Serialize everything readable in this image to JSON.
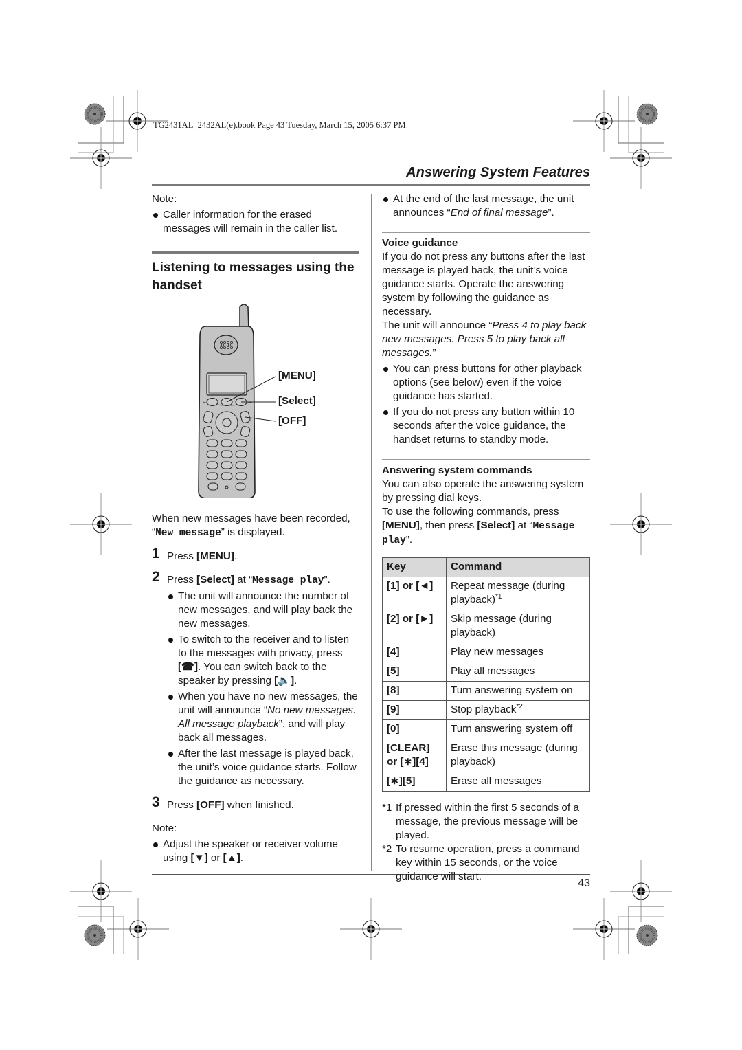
{
  "slug": "TG2431AL_2432AL(e).book  Page 43  Tuesday, March 15, 2005  6:37 PM",
  "section_title": "Answering System Features",
  "page_number": "43",
  "left": {
    "note1": {
      "label": "Note:",
      "bullet": "Caller information for the erased messages will remain in the caller list."
    },
    "heading": "Listening to messages using the handset",
    "figure": {
      "callouts": [
        "[MENU]",
        "[Select]",
        "[OFF]"
      ]
    },
    "intro_a": "When new messages have been recorded, “",
    "intro_lcd": "New message",
    "intro_b": "” is displayed.",
    "steps": [
      {
        "num": "1",
        "a": "Press ",
        "key": "[MENU]",
        "b": "."
      },
      {
        "num": "2",
        "a": "Press ",
        "key": "[Select]",
        "b": " at “",
        "lcd": "Message play",
        "c": "”."
      },
      {
        "num": "3",
        "a": "Press ",
        "key": "[OFF]",
        "b": " when finished."
      }
    ],
    "step2_bullets": {
      "b1": "The unit will announce the number of new messages, and will play back the new messages.",
      "b2_a": "To switch to the receiver and to listen to the messages with privacy, press ",
      "b2_key1": "[☎]",
      "b2_b": ". You can switch back to the speaker by pressing ",
      "b2_key2": "[🔈]",
      "b2_c": ".",
      "b3_a": "When you have no new messages, the unit will announce “",
      "b3_i": "No new messages. All message playback",
      "b3_b": "”, and will play back all messages.",
      "b4": "After the last message is played back, the unit’s voice guidance starts. Follow the guidance as necessary."
    },
    "note2": {
      "label": "Note:",
      "a": "Adjust the speaker or receiver volume using ",
      "key1": "[▼]",
      "mid": " or ",
      "key2": "[▲]",
      "b": "."
    }
  },
  "right": {
    "top_bullet_a": "At the end of the last message, the unit announces “",
    "top_bullet_i": "End of final message",
    "top_bullet_b": "”.",
    "voice": {
      "title": "Voice guidance",
      "p1": "If you do not press any buttons after the last message is played back, the unit’s voice guidance starts. Operate the answering system by following the guidance as necessary.",
      "p2_a": "The unit will announce “",
      "p2_i": "Press 4 to play back new messages. Press 5 to play back all messages.",
      "p2_b": "”",
      "b1": "You can press buttons for other playback options (see below) even if the voice guidance has started.",
      "b2": "If you do not press any button within 10 seconds after the voice guidance, the handset returns to standby mode."
    },
    "commands": {
      "title": "Answering system commands",
      "p1": "You can also operate the answering system by pressing dial keys.",
      "p2_a": "To use the following commands, press ",
      "p2_key1": "[MENU]",
      "p2_b": ", then press ",
      "p2_key2": "[Select]",
      "p2_c": " at “",
      "p2_lcd": "Message play",
      "p2_d": "”."
    },
    "table": {
      "headers": [
        "Key",
        "Command"
      ],
      "rows": [
        {
          "key": "[1] or [◄]",
          "command": "Repeat message (during playback)",
          "sup": "*1"
        },
        {
          "key": "[2] or [►]",
          "command": "Skip message (during playback)",
          "sup": ""
        },
        {
          "key": "[4]",
          "command": "Play new messages",
          "sup": ""
        },
        {
          "key": "[5]",
          "command": "Play all messages",
          "sup": ""
        },
        {
          "key": "[8]",
          "command": "Turn answering system on",
          "sup": ""
        },
        {
          "key": "[9]",
          "command": "Stop playback",
          "sup": "*2"
        },
        {
          "key": "[0]",
          "command": "Turn answering system off",
          "sup": ""
        },
        {
          "key": "[CLEAR] or [∗][4]",
          "command": "Erase this message (during playback)",
          "sup": ""
        },
        {
          "key": "[∗][5]",
          "command": "Erase all messages",
          "sup": ""
        }
      ]
    },
    "footnotes": [
      {
        "mark": "*1",
        "text": "If pressed within the first 5 seconds of a message, the previous message will be played."
      },
      {
        "mark": "*2",
        "text": "To resume operation, press a command key within 15 seconds, or the voice guidance will start."
      }
    ]
  }
}
